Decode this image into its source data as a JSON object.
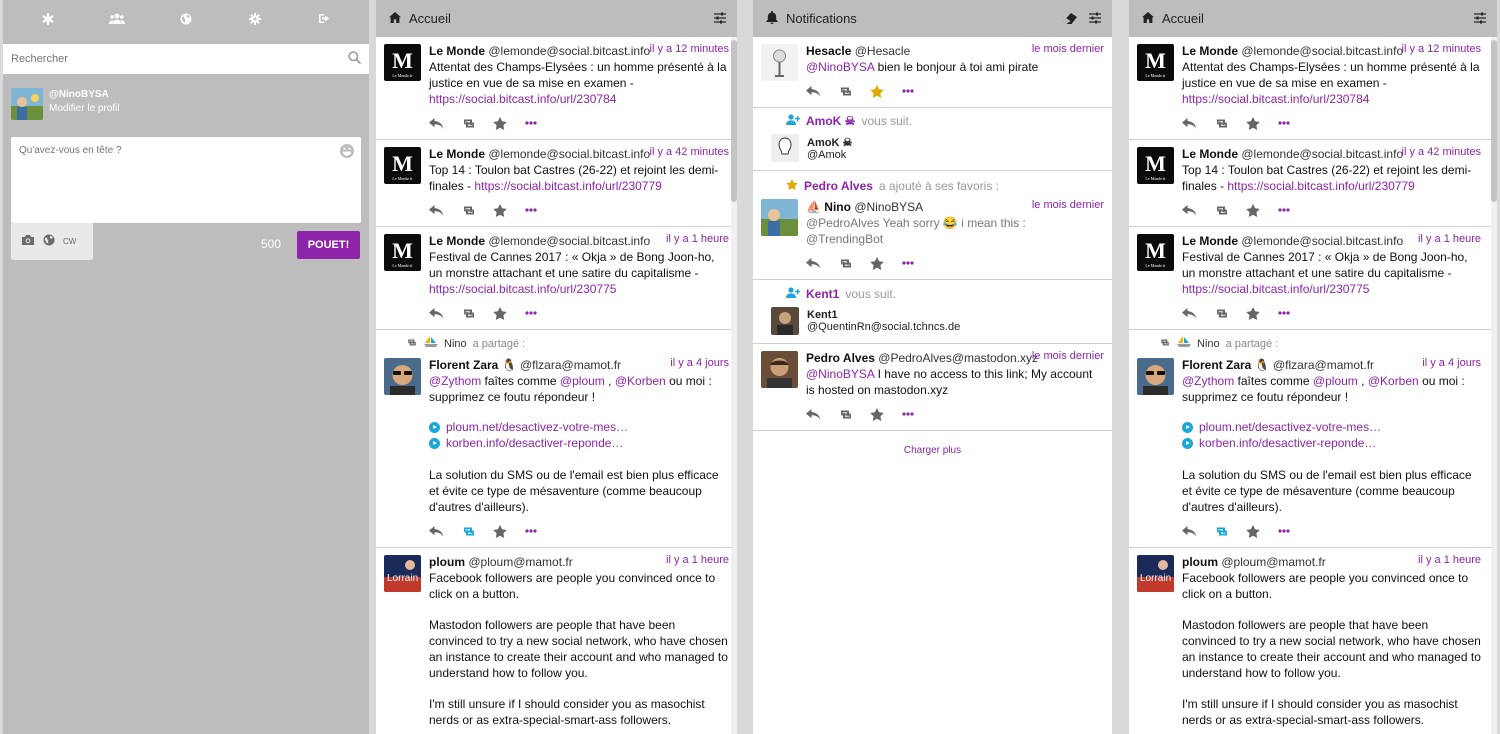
{
  "nav": {
    "icons": [
      "asterisk-icon",
      "users-icon",
      "globe-icon",
      "gear-icon",
      "logout-icon"
    ]
  },
  "search": {
    "placeholder": "Rechercher"
  },
  "profile": {
    "handle": "@NinoBYSA",
    "edit_label": "Modifier le profil"
  },
  "compose": {
    "placeholder": "Qu'avez-vous en tête ?",
    "cw_label": "CW",
    "char_count": "500",
    "submit_label": "POUET!"
  },
  "home_column": {
    "title": "Accueil",
    "statuses": [
      {
        "name": "Le Monde",
        "acct": "@lemonde@social.bitcast.info",
        "time": "il y a 12 minutes",
        "text": "Attentat des Champs-Elysées : un homme présenté à la justice en vue de sa mise en examen -",
        "link": "https://social.bitcast.info/url/230784"
      },
      {
        "name": "Le Monde",
        "acct": "@lemonde@social.bitcast.info",
        "time": "il y a 42 minutes",
        "text": "Top 14 : Toulon bat Castres (26-22) et rejoint les demi-finales -",
        "link": "https://social.bitcast.info/url/230779"
      },
      {
        "name": "Le Monde",
        "acct": "@lemonde@social.bitcast.info",
        "time": "il y a 1 heure",
        "text": "Festival de Cannes 2017 : « Okja » de Bong Joon-ho, un monstre attachant et une satire du capitalisme -",
        "link": "https://social.bitcast.info/url/230775"
      }
    ],
    "boost": {
      "booster": "Nino",
      "boosted_label": "a partagé :",
      "name": "Florent Zara",
      "acct": "@flzara@mamot.fr",
      "time": "il y a 4 jours",
      "mention1": "@Zythom",
      "text1": "faîtes comme",
      "mention2": "@ploum",
      "sep": ",",
      "mention3": "@Korben",
      "text2": "ou moi : supprimez ce foutu répondeur !",
      "card1": "ploum.net/desactivez-votre-mes…",
      "card2": "korben.info/desactiver-reponde…",
      "text3": "La solution du SMS ou de l'email est bien plus efficace et évite ce type de mésaventure (comme beaucoup d'autres d'ailleurs)."
    },
    "ploum": {
      "name": "ploum",
      "acct": "@ploum@mamot.fr",
      "time": "il y a 1 heure",
      "p1": "Facebook followers are people you convinced once to click on a button.",
      "p2": "Mastodon followers are people that have been convinced to try a new social network, who have chosen an instance to create their account and who managed to understand how to follow you.",
      "p3": "I'm still unsure if I should consider you as masochist nerds or as extra-special-smart-ass followers."
    }
  },
  "notifications_column": {
    "title": "Notifications",
    "hesacle": {
      "name": "Hesacle",
      "acct": "@Hesacle",
      "time": "le mois dernier",
      "mention": "@NinoBYSA",
      "text": "bien le bonjour à toi ami pirate"
    },
    "follow1": {
      "who": "AmoK ☠",
      "label": "vous suit.",
      "name": "AmoK ☠",
      "acct": "@Amok"
    },
    "fav": {
      "who": "Pedro Alves",
      "label": "a ajouté à ses favoris :",
      "name": "Nino",
      "acct": "@NinoBYSA",
      "time": "le mois dernier",
      "text": "@PedroAlves Yeah sorry 😂  i mean this : @TrendingBot"
    },
    "follow2": {
      "who": "Kent1",
      "label": "vous suit.",
      "name": "Kent1",
      "acct": "@QuentinRn@social.tchncs.de"
    },
    "pedro": {
      "name": "Pedro Alves",
      "acct": "@PedroAlves@mastodon.xyz",
      "time": "le mois dernier",
      "mention": "@NinoBYSA",
      "text": "I have no access to this link; My account is hosted on mastodon.xyz"
    },
    "load_more": "Charger plus"
  },
  "home_column_2": {
    "title": "Accueil"
  },
  "colors": {
    "accent": "#8e24aa",
    "column_header": "#bdbdbd",
    "boost_active": "#1aa6d9",
    "fav_active": "#e0a800"
  }
}
